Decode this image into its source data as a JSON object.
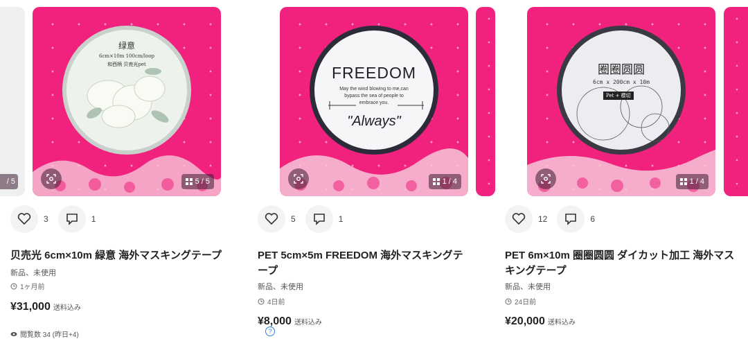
{
  "colors": {
    "accent": "#f0227d",
    "badge_bg": "#3c1e32"
  },
  "listings": [
    {
      "likes": "3",
      "comments": "1",
      "title": "贝売光 6cm×10m 緑意 海外マスキングテープ",
      "condition": "新品、未使用",
      "time": "1ヶ月前",
      "price": "¥31,000",
      "shipping": "送料込み",
      "photo_counter": "5 / 5",
      "tape_label_main": "绿意",
      "tape_label_sub": "6cm×10m  100cm/loop",
      "tape_label_sub2": "和西柄  贝売光pet",
      "views": "閲覧数 34 (昨日+4)"
    },
    {
      "likes": "5",
      "comments": "1",
      "title": "PET 5cm×5m FREEDOM 海外マスキングテープ",
      "condition": "新品、未使用",
      "time": "4日前",
      "price": "¥8,000",
      "shipping": "送料込み",
      "photo_counter": "1 / 4",
      "tape_label_main": "FREEDOM",
      "tape_label_sub": "May the wind blowing to me,can bypass the sea of people to embrace you.",
      "tape_label_sub2": "\"Always\""
    },
    {
      "likes": "12",
      "comments": "6",
      "title": "PET 6m×10m 圈圈圆圆 ダイカット加工 海外マスキングテープ",
      "condition": "新品、未使用",
      "time": "24日前",
      "price": "¥20,000",
      "shipping": "送料込み",
      "photo_counter": "1 / 4",
      "tape_label_main": "圈圈圆圆",
      "tape_label_sub": "6cm x 200cm x 10m",
      "tape_label_sub2": "Pet + 模切"
    }
  ],
  "left_peek_counter": "/ 5"
}
